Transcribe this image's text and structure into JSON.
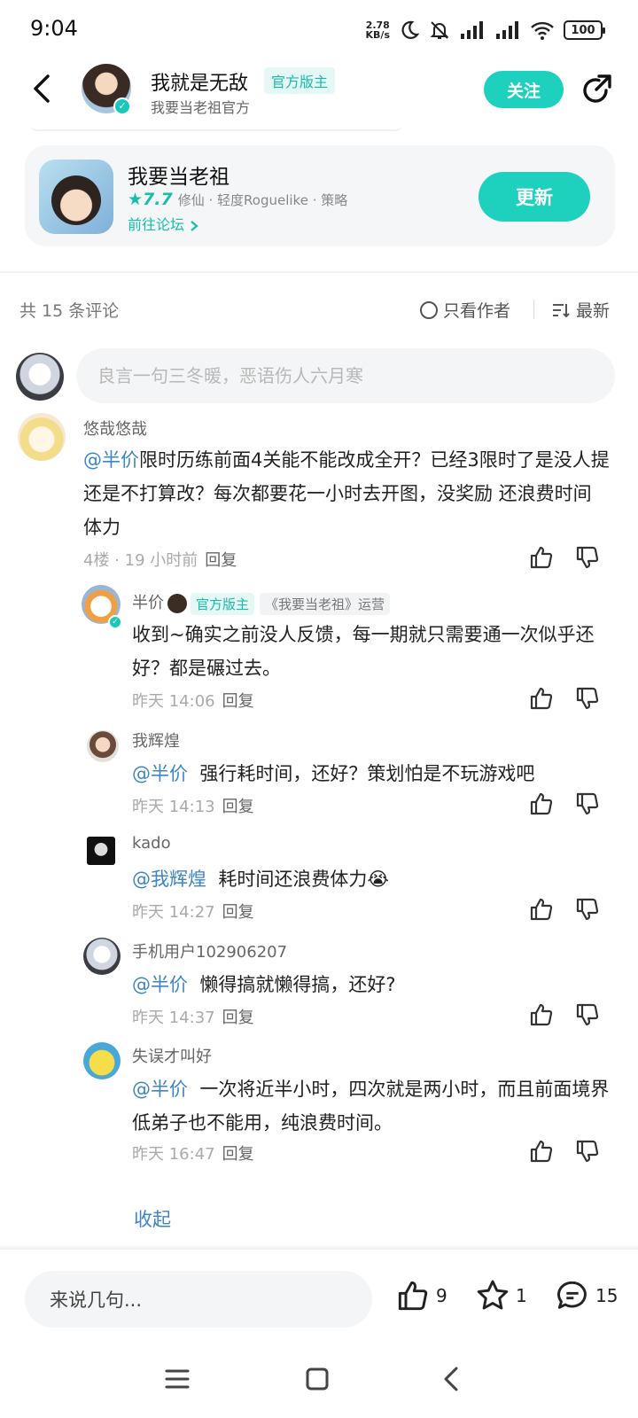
{
  "status_bar": {
    "time": "9:04",
    "net_speed_value": "2.78",
    "net_speed_unit": "KB/s",
    "battery": "100"
  },
  "header": {
    "author_name": "我就是无敌",
    "author_tag": "官方版主",
    "author_subtitle": "我要当老祖官方",
    "follow_label": "关注"
  },
  "game_card": {
    "title": "我要当老祖",
    "rating": "7.7",
    "tags": "修仙 · 轻度Roguelike · 策略",
    "forum_link": "前往论坛",
    "update_label": "更新"
  },
  "comments_header": {
    "count_text": "共 15 条评论",
    "only_author": "只看作者",
    "sort": "最新"
  },
  "comment_input": {
    "placeholder": "良言一句三冬暖，恶语伤人六月寒"
  },
  "main_comment": {
    "user": "悠哉悠哉",
    "mention": "@半价",
    "text": "限时历练前面4关能不能改成全开？已经3限时了是没人提还是不打算改？每次都要花一小时去开图，没奖励  还浪费时间 体力",
    "meta": "4楼 · 19 小时前",
    "reply_label": "回复"
  },
  "replies": [
    {
      "user": "半价",
      "tag_official": "官方版主",
      "tag_role": "《我要当老祖》运营",
      "mention": "",
      "text": "收到~确实之前没人反馈，每一期就只需要通一次似乎还好？都是碾过去。",
      "time": "昨天 14:06",
      "reply_label": "回复"
    },
    {
      "user": "我辉煌",
      "mention": "@半价",
      "text": "强行耗时间，还好？策划怕是不玩游戏吧",
      "time": "昨天 14:13",
      "reply_label": "回复"
    },
    {
      "user": "kado",
      "mention": "@我辉煌",
      "text": "耗时间还浪费体力😭",
      "time": "昨天 14:27",
      "reply_label": "回复"
    },
    {
      "user": "手机用户102906207",
      "mention": "@半价",
      "text": "懒得搞就懒得搞，还好?",
      "time": "昨天 14:37",
      "reply_label": "回复"
    },
    {
      "user": "失误才叫好",
      "mention": "@半价",
      "text": "一次将近半小时，四次就是两小时，而且前面境界低弟子也不能用，纯浪费时间。",
      "time": "昨天 16:47",
      "reply_label": "回复"
    }
  ],
  "collapse_label": "收起",
  "bottom_bar": {
    "input_placeholder": "来说几句...",
    "like_count": "9",
    "star_count": "1",
    "comment_count": "15"
  },
  "colors": {
    "accent": "#1dd1be",
    "mention": "#3d85c6"
  }
}
